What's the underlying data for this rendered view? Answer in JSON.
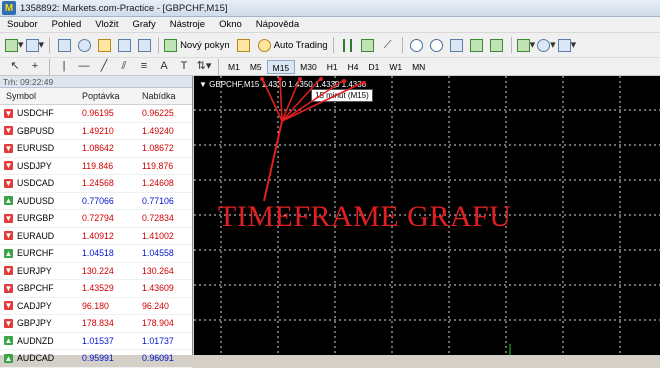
{
  "window": {
    "title": "1358892: Markets.com-Practice - [GBPCHF,M15]",
    "app_icon_letter": "M"
  },
  "menu": [
    "Soubor",
    "Pohled",
    "Vložit",
    "Grafy",
    "Nástroje",
    "Okno",
    "Nápověda"
  ],
  "toolbar": {
    "new_order": "Nový pokyn",
    "auto_trading": "Auto Trading"
  },
  "timeframes": [
    "M1",
    "M5",
    "M15",
    "M30",
    "H1",
    "H4",
    "D1",
    "W1",
    "MN"
  ],
  "active_timeframe": "M15",
  "market_watch": {
    "title": "Trh: 09:22:49",
    "columns": {
      "symbol": "Symbol",
      "bid": "Poptávka",
      "ask": "Nabídka"
    },
    "rows": [
      {
        "symbol": "USDCHF",
        "bid": "0.96195",
        "ask": "0.96225",
        "dir": "down"
      },
      {
        "symbol": "GBPUSD",
        "bid": "1.49210",
        "ask": "1.49240",
        "dir": "down"
      },
      {
        "symbol": "EURUSD",
        "bid": "1.08642",
        "ask": "1.08672",
        "dir": "down"
      },
      {
        "symbol": "USDJPY",
        "bid": "119.846",
        "ask": "119.876",
        "dir": "down"
      },
      {
        "symbol": "USDCAD",
        "bid": "1.24568",
        "ask": "1.24608",
        "dir": "down"
      },
      {
        "symbol": "AUDUSD",
        "bid": "0.77066",
        "ask": "0.77106",
        "dir": "up"
      },
      {
        "symbol": "EURGBP",
        "bid": "0.72794",
        "ask": "0.72834",
        "dir": "down"
      },
      {
        "symbol": "EURAUD",
        "bid": "1.40912",
        "ask": "1.41002",
        "dir": "down"
      },
      {
        "symbol": "EURCHF",
        "bid": "1.04518",
        "ask": "1.04558",
        "dir": "up"
      },
      {
        "symbol": "EURJPY",
        "bid": "130.224",
        "ask": "130.264",
        "dir": "down"
      },
      {
        "symbol": "GBPCHF",
        "bid": "1.43529",
        "ask": "1.43609",
        "dir": "down"
      },
      {
        "symbol": "CADJPY",
        "bid": "96.180",
        "ask": "96.240",
        "dir": "down"
      },
      {
        "symbol": "GBPJPY",
        "bid": "178.834",
        "ask": "178.904",
        "dir": "down"
      },
      {
        "symbol": "AUDNZD",
        "bid": "1.01537",
        "ask": "1.01737",
        "dir": "up"
      },
      {
        "symbol": "AUDCAD",
        "bid": "0.95991",
        "ask": "0.96091",
        "dir": "up"
      }
    ]
  },
  "chart": {
    "label": "GBPCHF,M15  1.4330 1.4350 1.4330 1.4330",
    "tooltip": "15 minut (M15)",
    "annotation": "TIMEFRAME GRAFU",
    "annotation_color": "#e02020",
    "background": "#000000",
    "grid_color": "#d9d9d9"
  },
  "colors": {
    "bid_down": "#d00000",
    "bid_up": "#0016c8",
    "arrow_down": "#e23b3b",
    "arrow_up": "#3ba447"
  }
}
